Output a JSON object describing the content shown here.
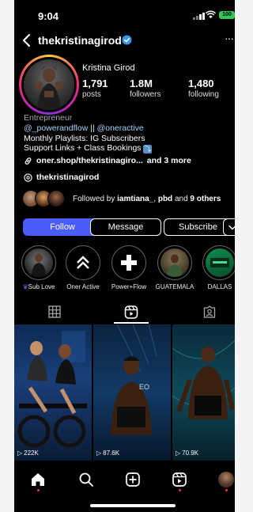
{
  "status_bar": {
    "time": "9:04",
    "battery": "100"
  },
  "header": {
    "username": "thekristinagirod",
    "more": "···"
  },
  "profile": {
    "full_name": "Kristina Girod",
    "stats": [
      {
        "value": "1,791",
        "label": "posts"
      },
      {
        "value": "1.8M",
        "label": "followers"
      },
      {
        "value": "1,480",
        "label": "following"
      }
    ],
    "category": "Entrepreneur",
    "mention_1": "@_powerandflow",
    "separator": " || ",
    "mention_2": "@oneractive",
    "bio_line_1": "Monthly Playlists: IG Subscribers",
    "bio_line_2": "Support Links + Class Bookings",
    "link_text": "oner.shop/thekristinagiro...",
    "link_more": "and 3 more",
    "threads_handle": "thekristinagirod",
    "followed_by_prefix": "Followed by ",
    "followed_by_user_1": "iamtiana_",
    "followed_by_sep": ", ",
    "followed_by_user_2": "pbd",
    "followed_by_mid": " and ",
    "followed_by_others": "9 others"
  },
  "actions": {
    "follow": "Follow",
    "message": "Message",
    "subscribe": "Subscribe"
  },
  "highlights": [
    {
      "label": "Sub Love",
      "icon": "crown-icon"
    },
    {
      "label": "Oner Active",
      "icon": "chevrons-up-icon"
    },
    {
      "label": "Power+Flow",
      "icon": "plus-icon"
    },
    {
      "label": "GUATEMALA",
      "icon": "photo"
    },
    {
      "label": "DALLAS",
      "icon": "photo"
    }
  ],
  "tabs": [
    "grid-icon",
    "reels-icon",
    "tagged-icon"
  ],
  "posts": [
    {
      "views": "222K"
    },
    {
      "views": "87.6K"
    },
    {
      "views": "70.9K"
    }
  ],
  "colors": {
    "accent": "#4a5df9",
    "mention": "#a4d3ff",
    "verified": "#3897f0",
    "notification": "#ff3040"
  }
}
